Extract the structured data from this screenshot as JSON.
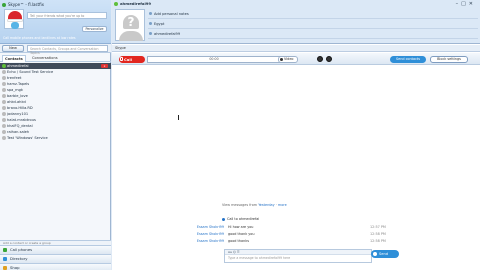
{
  "window": {
    "title": "Skype™ - fl.lastfix"
  },
  "profile": {
    "mood_placeholder": "Tell your friends what you're up to",
    "mood_button": "Personalize",
    "promo": "Call mobile phones and landlines at low rates"
  },
  "left_toolbar": {
    "new_label": "New",
    "search_placeholder": "Search Contacts, Groups and Conversation Topics"
  },
  "tabs": [
    {
      "label": "Contacts"
    },
    {
      "label": "Conversations"
    }
  ],
  "contacts": [
    {
      "name": "ahmedirefai",
      "status": "online",
      "selected": true,
      "close_label": "x"
    },
    {
      "name": "Echo / Sound Test Service",
      "status": "offline"
    },
    {
      "name": "trenfeet",
      "status": "offline"
    },
    {
      "name": "hamz.Tapels",
      "status": "offline"
    },
    {
      "name": "spa_mgk",
      "status": "offline"
    },
    {
      "name": "barbie_love",
      "status": "offline"
    },
    {
      "name": "ahkd.ahkd",
      "status": "offline"
    },
    {
      "name": "bravo.Hilla.RD",
      "status": "offline"
    },
    {
      "name": "jodanny101",
      "status": "offline"
    },
    {
      "name": "halat.mrabtrous",
      "status": "offline"
    },
    {
      "name": "khalFQ_dental",
      "status": "offline"
    },
    {
      "name": "raihan.saleh",
      "status": "offline"
    },
    {
      "name": "Test 'Windows' Service",
      "status": "offline"
    }
  ],
  "left_scroll_hint": "Add a contact or create a group",
  "bottom_nav": [
    {
      "label": "Call phones",
      "icon": "phone-icon",
      "color": "#3aa53a"
    },
    {
      "label": "Directory",
      "icon": "directory-icon",
      "color": "#2f8fd8"
    },
    {
      "label": "Shop",
      "icon": "shop-icon",
      "color": "#e0a020"
    }
  ],
  "conversation": {
    "contact_name": "ahmedirefai99",
    "info": [
      "Add personal notes",
      "Egypt",
      "ahmedirefai99"
    ],
    "header_tab": "Skype",
    "call_label": "Call",
    "call_field": "00:00",
    "video_label": "Video",
    "send_contacts": "Send contacts",
    "block_label": "Block settings",
    "view_messages": "View messages from",
    "view_link": "Yesterday",
    "view_more": "more",
    "call_line": "Call to ahmedirefai",
    "messages": [
      {
        "who": "Essam Shokri99",
        "text": "Hi how are you",
        "time": "12:57 PM"
      },
      {
        "who": "Essam Shokri99",
        "text": "good thank you",
        "time": "12:58 PM"
      },
      {
        "who": "Essam Shokri99",
        "text": "good thanks",
        "time": "12:58 PM"
      }
    ],
    "compose_toolbar": "Aa  ☺  ☰",
    "compose_placeholder": "Type a message to ahmedirefai99 here",
    "send_label": "Send message"
  }
}
